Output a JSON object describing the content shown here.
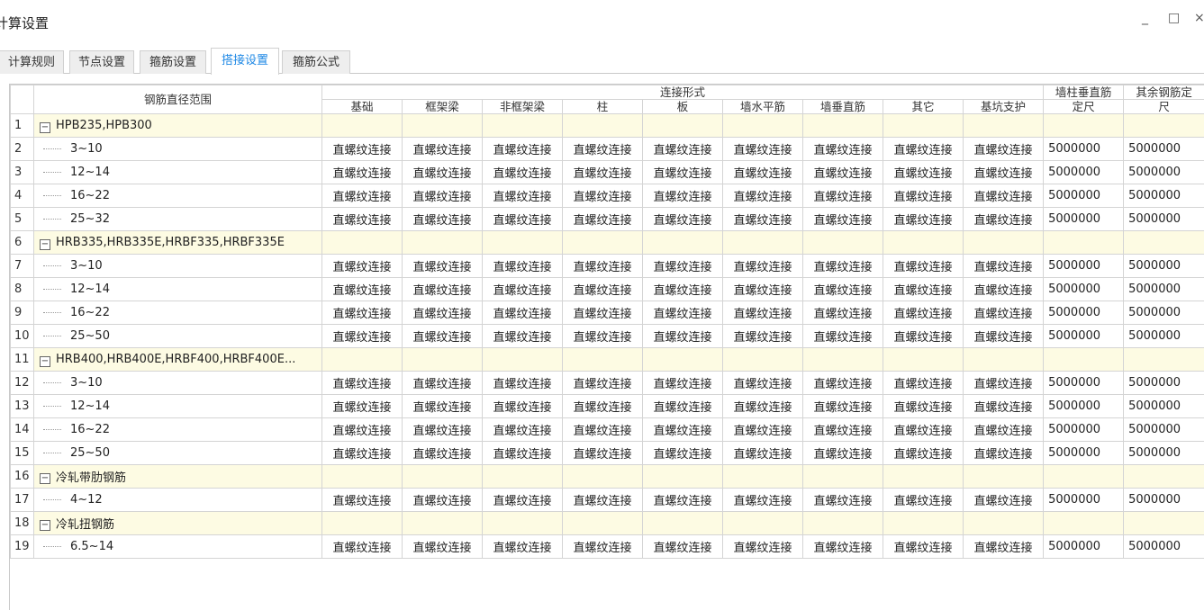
{
  "window": {
    "title": "计算设置",
    "minimize": "_",
    "maximize": "□",
    "close": "×"
  },
  "tabs": [
    {
      "label": "计算规则",
      "active": false
    },
    {
      "label": "节点设置",
      "active": false
    },
    {
      "label": "箍筋设置",
      "active": false
    },
    {
      "label": "搭接设置",
      "active": true
    },
    {
      "label": "箍筋公式",
      "active": false
    }
  ],
  "table": {
    "header_range": "钢筋直径范围",
    "header_group": "连接形式",
    "columns": [
      "基础",
      "框架梁",
      "非框架梁",
      "柱",
      "板",
      "墙水平筋",
      "墙垂直筋",
      "其它",
      "基坑支护"
    ],
    "col_wall_len_1": "墙柱垂直筋",
    "col_wall_len_2": "定尺",
    "col_other_len_1": "其余钢筋定",
    "col_other_len_2": "尺",
    "rows": [
      {
        "num": "1",
        "type": "group",
        "name": "HPB235,HPB300"
      },
      {
        "num": "2",
        "type": "item",
        "name": "3~10",
        "values": [
          "直螺纹连接",
          "直螺纹连接",
          "直螺纹连接",
          "直螺纹连接",
          "直螺纹连接",
          "直螺纹连接",
          "直螺纹连接",
          "直螺纹连接",
          "直螺纹连接"
        ],
        "wall_len": "5000000",
        "other_len": "5000000"
      },
      {
        "num": "3",
        "type": "item",
        "name": "12~14",
        "values": [
          "直螺纹连接",
          "直螺纹连接",
          "直螺纹连接",
          "直螺纹连接",
          "直螺纹连接",
          "直螺纹连接",
          "直螺纹连接",
          "直螺纹连接",
          "直螺纹连接"
        ],
        "wall_len": "5000000",
        "other_len": "5000000"
      },
      {
        "num": "4",
        "type": "item",
        "name": "16~22",
        "values": [
          "直螺纹连接",
          "直螺纹连接",
          "直螺纹连接",
          "直螺纹连接",
          "直螺纹连接",
          "直螺纹连接",
          "直螺纹连接",
          "直螺纹连接",
          "直螺纹连接"
        ],
        "wall_len": "5000000",
        "other_len": "5000000"
      },
      {
        "num": "5",
        "type": "item",
        "name": "25~32",
        "values": [
          "直螺纹连接",
          "直螺纹连接",
          "直螺纹连接",
          "直螺纹连接",
          "直螺纹连接",
          "直螺纹连接",
          "直螺纹连接",
          "直螺纹连接",
          "直螺纹连接"
        ],
        "wall_len": "5000000",
        "other_len": "5000000"
      },
      {
        "num": "6",
        "type": "group",
        "name": "HRB335,HRB335E,HRBF335,HRBF335E"
      },
      {
        "num": "7",
        "type": "item",
        "name": "3~10",
        "values": [
          "直螺纹连接",
          "直螺纹连接",
          "直螺纹连接",
          "直螺纹连接",
          "直螺纹连接",
          "直螺纹连接",
          "直螺纹连接",
          "直螺纹连接",
          "直螺纹连接"
        ],
        "wall_len": "5000000",
        "other_len": "5000000"
      },
      {
        "num": "8",
        "type": "item",
        "name": "12~14",
        "values": [
          "直螺纹连接",
          "直螺纹连接",
          "直螺纹连接",
          "直螺纹连接",
          "直螺纹连接",
          "直螺纹连接",
          "直螺纹连接",
          "直螺纹连接",
          "直螺纹连接"
        ],
        "wall_len": "5000000",
        "other_len": "5000000"
      },
      {
        "num": "9",
        "type": "item",
        "name": "16~22",
        "values": [
          "直螺纹连接",
          "直螺纹连接",
          "直螺纹连接",
          "直螺纹连接",
          "直螺纹连接",
          "直螺纹连接",
          "直螺纹连接",
          "直螺纹连接",
          "直螺纹连接"
        ],
        "wall_len": "5000000",
        "other_len": "5000000"
      },
      {
        "num": "10",
        "type": "item",
        "name": "25~50",
        "values": [
          "直螺纹连接",
          "直螺纹连接",
          "直螺纹连接",
          "直螺纹连接",
          "直螺纹连接",
          "直螺纹连接",
          "直螺纹连接",
          "直螺纹连接",
          "直螺纹连接"
        ],
        "wall_len": "5000000",
        "other_len": "5000000"
      },
      {
        "num": "11",
        "type": "group",
        "name": "HRB400,HRB400E,HRBF400,HRBF400E..."
      },
      {
        "num": "12",
        "type": "item",
        "name": "3~10",
        "values": [
          "直螺纹连接",
          "直螺纹连接",
          "直螺纹连接",
          "直螺纹连接",
          "直螺纹连接",
          "直螺纹连接",
          "直螺纹连接",
          "直螺纹连接",
          "直螺纹连接"
        ],
        "wall_len": "5000000",
        "other_len": "5000000"
      },
      {
        "num": "13",
        "type": "item",
        "name": "12~14",
        "values": [
          "直螺纹连接",
          "直螺纹连接",
          "直螺纹连接",
          "直螺纹连接",
          "直螺纹连接",
          "直螺纹连接",
          "直螺纹连接",
          "直螺纹连接",
          "直螺纹连接"
        ],
        "wall_len": "5000000",
        "other_len": "5000000"
      },
      {
        "num": "14",
        "type": "item",
        "name": "16~22",
        "values": [
          "直螺纹连接",
          "直螺纹连接",
          "直螺纹连接",
          "直螺纹连接",
          "直螺纹连接",
          "直螺纹连接",
          "直螺纹连接",
          "直螺纹连接",
          "直螺纹连接"
        ],
        "wall_len": "5000000",
        "other_len": "5000000"
      },
      {
        "num": "15",
        "type": "item",
        "name": "25~50",
        "values": [
          "直螺纹连接",
          "直螺纹连接",
          "直螺纹连接",
          "直螺纹连接",
          "直螺纹连接",
          "直螺纹连接",
          "直螺纹连接",
          "直螺纹连接",
          "直螺纹连接"
        ],
        "wall_len": "5000000",
        "other_len": "5000000"
      },
      {
        "num": "16",
        "type": "group",
        "name": "冷轧带肋钢筋"
      },
      {
        "num": "17",
        "type": "item",
        "name": "4~12",
        "values": [
          "直螺纹连接",
          "直螺纹连接",
          "直螺纹连接",
          "直螺纹连接",
          "直螺纹连接",
          "直螺纹连接",
          "直螺纹连接",
          "直螺纹连接",
          "直螺纹连接"
        ],
        "wall_len": "5000000",
        "other_len": "5000000"
      },
      {
        "num": "18",
        "type": "group",
        "name": "冷轧扭钢筋"
      },
      {
        "num": "19",
        "type": "item",
        "name": "6.5~14",
        "values": [
          "直螺纹连接",
          "直螺纹连接",
          "直螺纹连接",
          "直螺纹连接",
          "直螺纹连接",
          "直螺纹连接",
          "直螺纹连接",
          "直螺纹连接",
          "直螺纹连接"
        ],
        "wall_len": "5000000",
        "other_len": "5000000"
      }
    ]
  },
  "colors": {
    "active_tab": "#1e88e5",
    "group_row_bg": "#fdfbe3",
    "grid_line": "#d4d4d4"
  },
  "icons": {
    "collapse": "minus-box-icon"
  }
}
